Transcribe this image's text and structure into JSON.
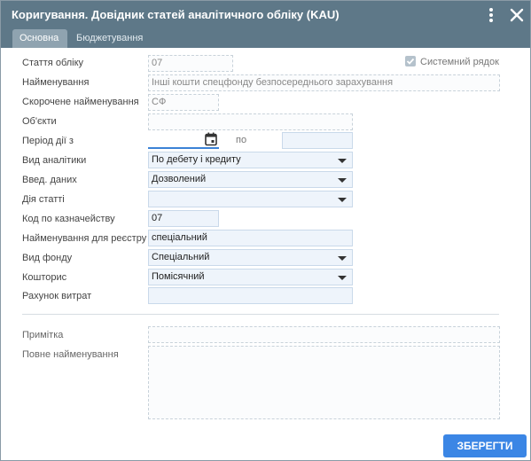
{
  "window": {
    "title": "Коригування. Довідник статей аналітичного обліку (KAU)",
    "tabs": [
      {
        "label": "Основна",
        "active": true
      },
      {
        "label": "Бюджетування",
        "active": false
      }
    ]
  },
  "form": {
    "article": {
      "label": "Стаття обліку",
      "value": "07"
    },
    "system_row": {
      "label": "Системний рядок",
      "checked": true
    },
    "name": {
      "label": "Найменування",
      "value": "Інші кошти спецфонду безпосереднього зарахування"
    },
    "short_name": {
      "label": "Скорочене найменування",
      "value": "СФ"
    },
    "objects": {
      "label": "Об'єкти",
      "value": ""
    },
    "period": {
      "label": "Період дії з",
      "from": "",
      "to_label": "по",
      "to": ""
    },
    "analytics_type": {
      "label": "Вид аналітики",
      "value": "По дебету і кредиту"
    },
    "data_entry": {
      "label": "Введ. даних",
      "value": "Дозволений"
    },
    "article_action": {
      "label": "Дія статті",
      "value": ""
    },
    "treasury_code": {
      "label": "Код по казначейству",
      "value": "07"
    },
    "registry_name": {
      "label": "Найменування для реєстру",
      "value": "спеціальний"
    },
    "fund_type": {
      "label": "Вид фонду",
      "value": "Спеціальний"
    },
    "budget": {
      "label": "Кошторис",
      "value": "Помісячний"
    },
    "expense_account": {
      "label": "Рахунок витрат",
      "value": ""
    },
    "note": {
      "label": "Примітка",
      "value": ""
    },
    "full_name": {
      "label": "Повне найменування",
      "value": ""
    }
  },
  "footer": {
    "save_label": "ЗБЕРЕГТИ"
  },
  "colors": {
    "titlebar": "#5e7888",
    "accent": "#3b86e5",
    "field_bg": "#eef4fb"
  },
  "icons": [
    "kebab-menu-icon",
    "close-icon",
    "checkbox-checked-icon",
    "calendar-icon",
    "chevron-down-icon"
  ]
}
